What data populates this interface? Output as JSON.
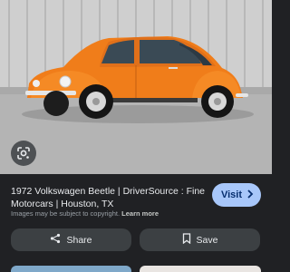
{
  "result": {
    "title": "1972 Volkswagen Beetle | DriverSource : Fine Motorcars | Houston, TX",
    "visit_label": "Visit",
    "copyright_text": "Images may be subject to copyright.",
    "learn_more_label": "Learn more"
  },
  "actions": {
    "share_label": "Share",
    "save_label": "Save"
  },
  "icons": {
    "lens": "google-lens-icon",
    "visit": "chevron-right-icon",
    "share": "share-icon",
    "save": "bookmark-icon"
  },
  "colors": {
    "background": "#202124",
    "visit_button": "#a8c7fa",
    "action_button": "#3c4043",
    "car_body": "#f07d1a"
  }
}
